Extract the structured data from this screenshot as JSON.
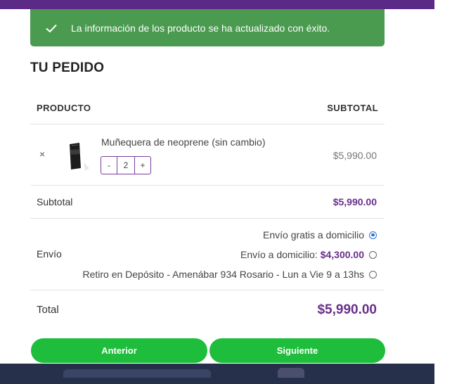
{
  "notice": {
    "message": "La información de los producto se ha actualizado con éxito."
  },
  "order": {
    "heading": "TU PEDIDO",
    "columns": {
      "product": "PRODUCTO",
      "subtotal": "SUBTOTAL"
    },
    "item": {
      "remove": "×",
      "name": "Muñequera de neoprene (sin cambio)",
      "qty_minus": "-",
      "qty": "2",
      "qty_plus": "+",
      "price": "$5,990.00"
    },
    "subtotal": {
      "label": "Subtotal",
      "amount": "$5,990.00"
    },
    "shipping": {
      "label": "Envío",
      "options": [
        {
          "label": "Envío gratis a domicilio",
          "amount": "",
          "selected": true
        },
        {
          "label": "Envío a domicilio:",
          "amount": "$4,300.00",
          "selected": false
        },
        {
          "label": "Retiro en Depósito - Amenábar 934 Rosario - Lun a Vie 9 a 13hs",
          "amount": "",
          "selected": false
        }
      ]
    },
    "total": {
      "label": "Total",
      "amount": "$5,990.00"
    }
  },
  "buttons": {
    "prev": "Anterior",
    "next": "Siguiente"
  },
  "colors": {
    "accent": "#6a2f8a",
    "success": "#4a9a4f",
    "button": "#1fbd3c"
  }
}
